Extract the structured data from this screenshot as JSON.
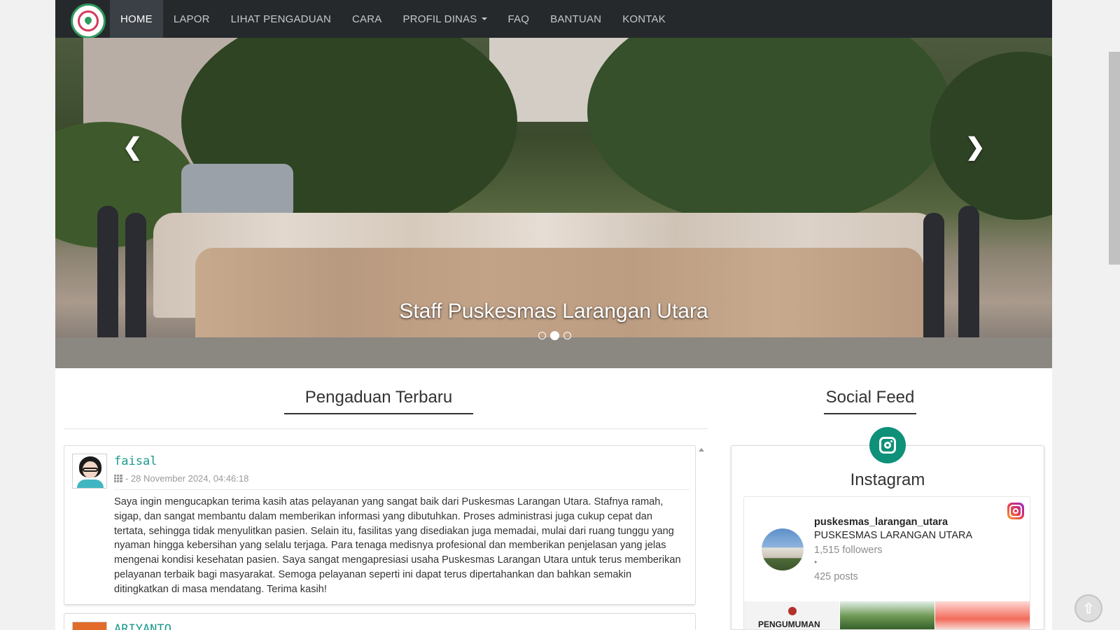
{
  "nav": {
    "logo_alt": "Puskesmas logo",
    "items": [
      {
        "label": "HOME",
        "active": true
      },
      {
        "label": "LAPOR"
      },
      {
        "label": "LIHAT PENGADUAN"
      },
      {
        "label": "CARA"
      },
      {
        "label": "PROFIL DINAS",
        "dropdown": true
      },
      {
        "label": "FAQ"
      },
      {
        "label": "BANTUAN"
      },
      {
        "label": "KONTAK"
      }
    ]
  },
  "hero": {
    "caption": "Staff Puskesmas Larangan Utara",
    "active_slide": 2,
    "slide_count": 3,
    "prev_icon": "chevron-left-icon",
    "next_icon": "chevron-right-icon"
  },
  "complaints": {
    "title": "Pengaduan Terbaru",
    "items": [
      {
        "name": "faisal",
        "date": "- 28 November 2024, 04:46:18",
        "text": "Saya ingin mengucapkan terima kasih atas pelayanan yang sangat baik dari Puskesmas Larangan Utara. Stafnya ramah, sigap, dan sangat membantu dalam memberikan informasi yang dibutuhkan. Proses administrasi juga cukup cepat dan tertata, sehingga tidak menyulitkan pasien. Selain itu, fasilitas yang disediakan juga memadai, mulai dari ruang tunggu yang nyaman hingga kebersihan yang selalu terjaga. Para tenaga medisnya profesional dan memberikan penjelasan yang jelas mengenai kondisi kesehatan pasien. Saya sangat mengapresiasi usaha Puskesmas Larangan Utara untuk terus memberikan pelayanan terbaik bagi masyarakat. Semoga pelayanan seperti ini dapat terus dipertahankan dan bahkan semakin ditingkatkan di masa mendatang. Terima kasih!"
      },
      {
        "name": "ARIYANTO"
      }
    ]
  },
  "social": {
    "title": "Social Feed",
    "platform": "Instagram",
    "handle": "puskesmas_larangan_utara",
    "display_name": "PUSKESMAS LARANGAN UTARA",
    "followers": "1,515 followers",
    "bullet": "•",
    "posts": "425 posts",
    "thumb1_text": "PENGUMUMAN"
  },
  "colors": {
    "nav_bg": "#25292c",
    "accent_teal": "#1a9a8c",
    "instagram_green": "#0e9079"
  },
  "back_to_top_icon": "arrow-up-circle-icon"
}
